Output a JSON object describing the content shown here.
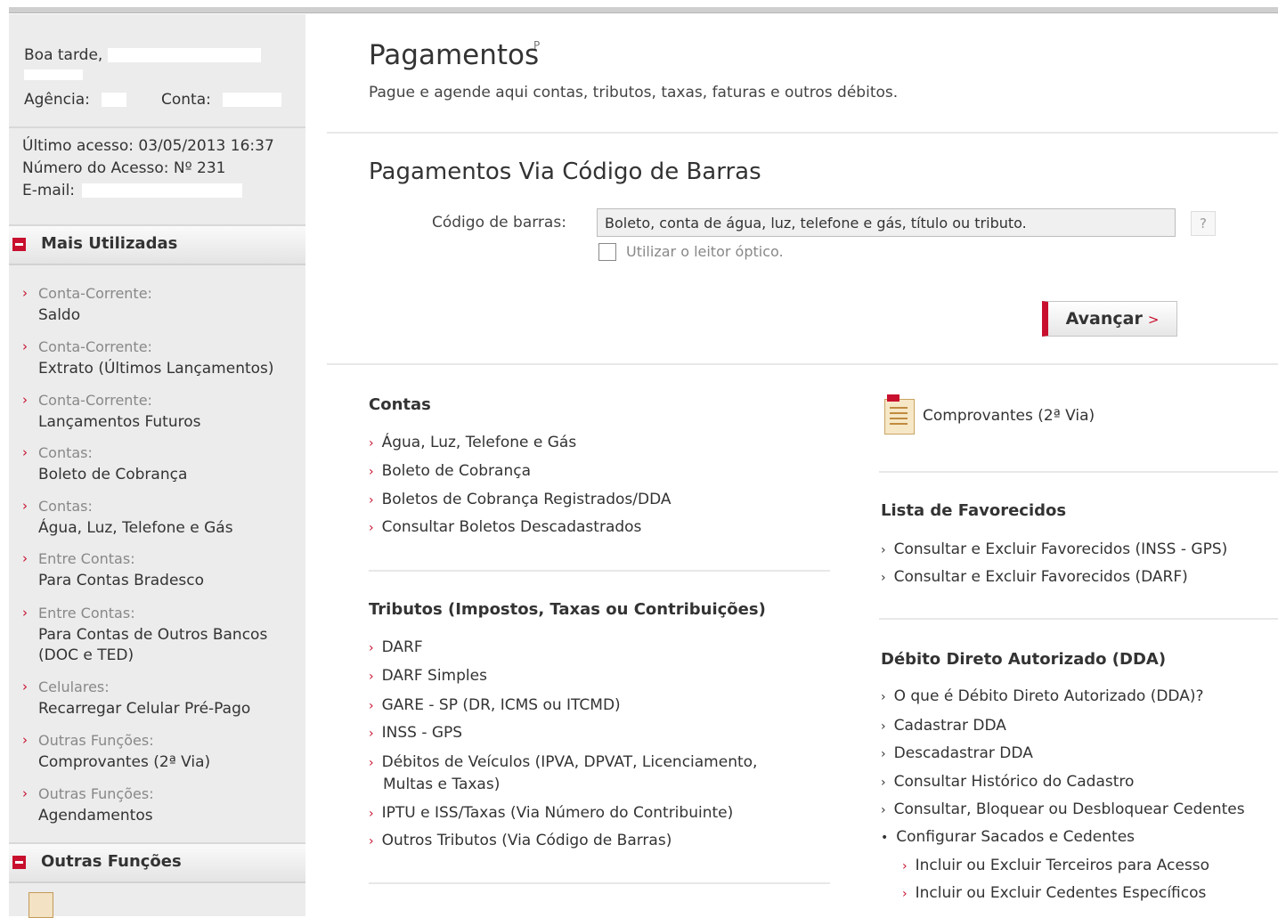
{
  "sidebar": {
    "greeting": "Boa tarde,",
    "agencia_label": "Agência:",
    "conta_label": "Conta:",
    "ultimo_acesso": "Último acesso: 03/05/2013 16:37",
    "numero_acesso": "Número do Acesso: Nº 231",
    "email_label": "E-mail:",
    "mais_utilizadas_title": "Mais Utilizadas",
    "items": [
      {
        "category": "Conta-Corrente:",
        "label": "Saldo"
      },
      {
        "category": "Conta-Corrente:",
        "label": "Extrato (Últimos Lançamentos)"
      },
      {
        "category": "Conta-Corrente:",
        "label": "Lançamentos Futuros"
      },
      {
        "category": "Contas:",
        "label": "Boleto de Cobrança"
      },
      {
        "category": "Contas:",
        "label": "Água, Luz, Telefone e Gás"
      },
      {
        "category": "Entre Contas:",
        "label": "Para Contas Bradesco"
      },
      {
        "category": "Entre Contas:",
        "label": "Para Contas de Outros Bancos (DOC e TED)"
      },
      {
        "category": "Celulares:",
        "label": "Recarregar Celular Pré-Pago"
      },
      {
        "category": "Outras Funções:",
        "label": "Comprovantes (2ª Via)"
      },
      {
        "category": "Outras Funções:",
        "label": "Agendamentos"
      }
    ],
    "outras_funcoes_title": "Outras Funções"
  },
  "header": {
    "title": "Pagamentos",
    "title_sup": "P",
    "subtitle": "Pague e agende aqui contas, tributos, taxas, faturas e outros débitos."
  },
  "barcode": {
    "section_title": "Pagamentos Via Código de Barras",
    "label": "Código de barras:",
    "value": "Boleto, conta de água, luz, telefone e gás, título ou tributo.",
    "help": "?",
    "checkbox_label": "Utilizar o leitor óptico.",
    "submit_label": "Avançar",
    "submit_chevron": ">"
  },
  "contas": {
    "title": "Contas",
    "links": [
      "Água, Luz, Telefone e Gás",
      "Boleto de Cobrança",
      "Boletos de Cobrança Registrados/DDA",
      "Consultar Boletos Descadastrados"
    ]
  },
  "tributos": {
    "title": "Tributos (Impostos, Taxas ou Contribuições)",
    "links": [
      "DARF",
      "DARF Simples",
      "GARE - SP (DR, ICMS ou ITCMD)",
      "INSS - GPS",
      "Débitos de Veículos (IPVA, DPVAT, Licenciamento,",
      "Multas e Taxas)",
      "IPTU e ISS/Taxas (Via Número do Contribuinte)",
      "Outros Tributos (Via Código de Barras)"
    ]
  },
  "comprovantes": {
    "label": "Comprovantes (2ª Via)"
  },
  "favorecidos": {
    "title": "Lista de Favorecidos",
    "links": [
      "Consultar e Excluir Favorecidos (INSS - GPS)",
      "Consultar e Excluir Favorecidos (DARF)"
    ]
  },
  "dda": {
    "title": "Débito Direto Autorizado (DDA)",
    "links": [
      "O que é Débito Direto Autorizado (DDA)?",
      "Cadastrar DDA",
      "Descadastrar DDA",
      "Consultar Histórico do Cadastro",
      "Consultar, Bloquear ou Desbloquear Cedentes",
      "Configurar Sacados e Cedentes"
    ],
    "sublinks": [
      "Incluir ou Excluir Terceiros para Acesso",
      "Incluir ou Excluir Cedentes Específicos"
    ]
  },
  "colors": {
    "accent": "#c8102e",
    "sidebar_bg": "#ececec"
  }
}
